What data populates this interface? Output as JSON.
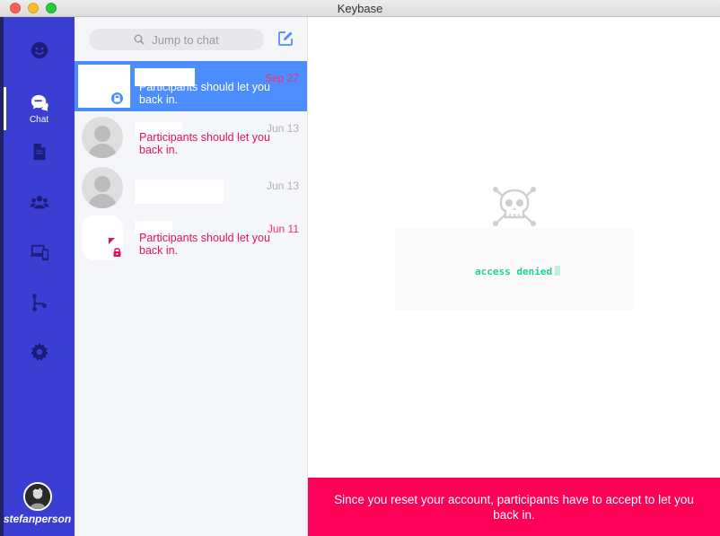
{
  "window": {
    "title": "Keybase"
  },
  "nav": {
    "items": [
      {
        "name": "people",
        "icon": "people-icon",
        "label": ""
      },
      {
        "name": "chat",
        "icon": "chat-icon",
        "label": "Chat"
      },
      {
        "name": "files",
        "icon": "files-icon",
        "label": ""
      },
      {
        "name": "teams",
        "icon": "teams-icon",
        "label": ""
      },
      {
        "name": "devices",
        "icon": "devices-icon",
        "label": ""
      },
      {
        "name": "git",
        "icon": "git-icon",
        "label": ""
      },
      {
        "name": "settings",
        "icon": "gear-icon",
        "label": ""
      }
    ],
    "username": "stefanperson"
  },
  "inbox": {
    "search_placeholder": "Jump to chat",
    "conversations": [
      {
        "timestamp": "Sep 27",
        "snippet": "Participants should let you back in.",
        "selected": true
      },
      {
        "timestamp": "Jun 13",
        "snippet": "Participants should let you back in.",
        "selected": false
      },
      {
        "timestamp": "Jun 13",
        "snippet": "",
        "selected": false
      },
      {
        "timestamp": "Jun 11",
        "snippet": "Participants should let you back in.",
        "selected": false
      }
    ]
  },
  "conversation": {
    "access_text": "access denied",
    "banner": "Since you reset your account, participants have to accept to let you back in."
  },
  "colors": {
    "nav_bg": "#3b3ed3",
    "selected_row": "#4c8eff",
    "banner": "#ff0059",
    "error_text": "#e0115f",
    "terminal_green": "#19d68f"
  }
}
